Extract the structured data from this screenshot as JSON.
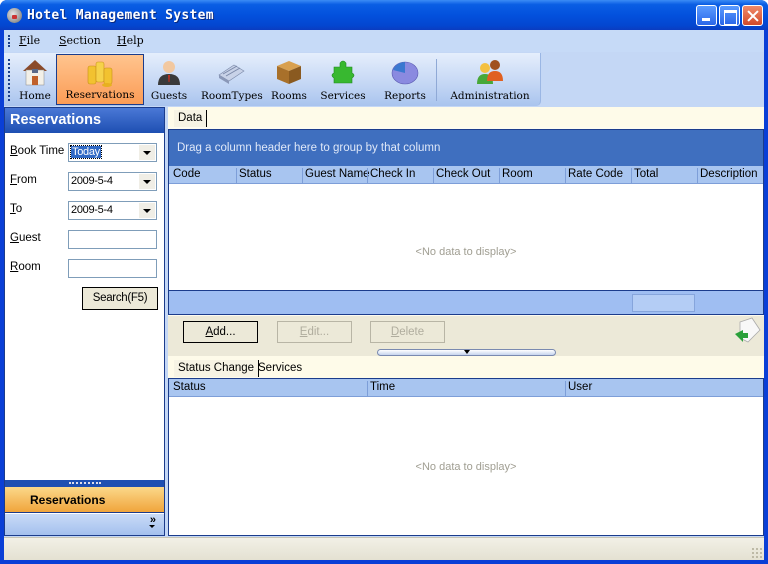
{
  "window": {
    "title": "Hotel Management System",
    "controls": {
      "minimize": "minimize",
      "maximize": "maximize",
      "close": "close"
    }
  },
  "menubar": {
    "items": [
      {
        "label": "File",
        "mnemonic": "F"
      },
      {
        "label": "Section",
        "mnemonic": "S"
      },
      {
        "label": "Help",
        "mnemonic": "H"
      }
    ]
  },
  "toolbar": {
    "buttons": [
      {
        "label": "Home",
        "icon": "house-icon",
        "active": false
      },
      {
        "label": "Reservations",
        "icon": "coins-icon",
        "active": true
      },
      {
        "label": "Guests",
        "icon": "person-icon",
        "active": false
      },
      {
        "label": "RoomTypes",
        "icon": "room-types-icon",
        "active": false
      },
      {
        "label": "Rooms",
        "icon": "box-icon",
        "active": false
      },
      {
        "label": "Services",
        "icon": "puzzle-icon",
        "active": false
      },
      {
        "label": "Reports",
        "icon": "pie-chart-icon",
        "active": false
      },
      {
        "label": "Administration",
        "icon": "users-icon",
        "active": false
      }
    ]
  },
  "nav": {
    "header": "Reservations",
    "form": {
      "book_time": {
        "label": "Book Time",
        "mnemonic": "B",
        "value": "Today"
      },
      "from": {
        "label": "From",
        "mnemonic": "F",
        "value": "2009-5-4"
      },
      "to": {
        "label": "To",
        "mnemonic": "T",
        "value": "2009-5-4"
      },
      "guest": {
        "label": "Guest",
        "mnemonic": "G",
        "value": ""
      },
      "room": {
        "label": "Room",
        "mnemonic": "R",
        "value": ""
      },
      "search_label": "Search(F5)"
    },
    "group_label": "Reservations",
    "footer_chevron": "»"
  },
  "main": {
    "tabs": [
      {
        "label": "Data"
      }
    ],
    "group_panel_text": "Drag a column header here to group by that column",
    "columns": [
      "Code",
      "Status",
      "Guest Name",
      "Check In",
      "Check Out",
      "Room",
      "Rate Code",
      "Total",
      "Description"
    ],
    "rows": [],
    "empty_text": "<No data to display>",
    "actions": {
      "add": {
        "label": "Add...",
        "enabled": true
      },
      "edit": {
        "label": "Edit...",
        "enabled": false
      },
      "delete": {
        "label": "Delete",
        "enabled": false
      }
    },
    "detail_tabs": [
      {
        "label": "Status Change"
      },
      {
        "label": "Services"
      }
    ],
    "detail_columns": [
      "Status",
      "Time",
      "User"
    ],
    "detail_rows": [],
    "detail_empty_text": "<No data to display>"
  },
  "colors": {
    "titlebar": "#0351dd",
    "active_toolbar": "#fb9c56",
    "nav_header": "#1e4fb2",
    "group_panel": "#3f6fbf",
    "column_header": "#a8c5f0",
    "nav_group": "#f0a53c"
  }
}
